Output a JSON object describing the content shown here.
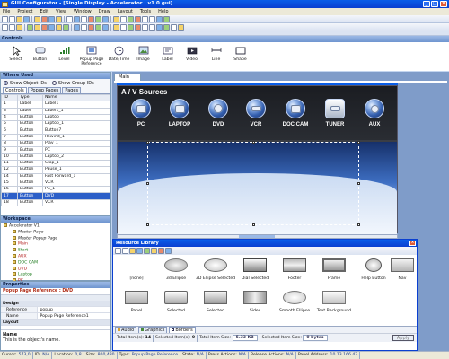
{
  "window": {
    "title": "GUI Configurator - [Single Display - Accelerator : v1.0.gui]"
  },
  "menu": [
    "File",
    "Project",
    "Edit",
    "View",
    "Window",
    "Draw",
    "Layout",
    "Tools",
    "Help"
  ],
  "controls_panel": {
    "title": "Controls",
    "items": [
      {
        "label": "Select",
        "icon": "pointer-icon"
      },
      {
        "label": "Button",
        "icon": "button-icon"
      },
      {
        "label": "Level",
        "icon": "level-icon"
      },
      {
        "label": "Popup Page Reference",
        "icon": "popup-page-icon"
      },
      {
        "label": "Date/Time",
        "icon": "clock-icon"
      },
      {
        "label": "Image",
        "icon": "image-icon"
      },
      {
        "label": "Label",
        "icon": "label-icon"
      },
      {
        "label": "Video",
        "icon": "video-icon"
      },
      {
        "label": "Line",
        "icon": "line-icon"
      },
      {
        "label": "Shape",
        "icon": "shape-icon"
      }
    ]
  },
  "where_used": {
    "title": "Where Used",
    "radio_object": "Show Object IDs",
    "radio_group": "Show Group IDs",
    "tabs": [
      "Controls",
      "Popup Pages",
      "Pages"
    ],
    "columns": [
      "ID",
      "Type",
      "Name"
    ],
    "rows": [
      [
        "1",
        "Label",
        "Label1"
      ],
      [
        "3",
        "Label",
        "Label1_1"
      ],
      [
        "4",
        "Button",
        "Laptop"
      ],
      [
        "5",
        "Button",
        "Laptop_1"
      ],
      [
        "6",
        "Button",
        "Button7"
      ],
      [
        "7",
        "Button",
        "Rewind_1"
      ],
      [
        "8",
        "Button",
        "Play_1"
      ],
      [
        "9",
        "Button",
        "PC"
      ],
      [
        "10",
        "Button",
        "Laptop_2"
      ],
      [
        "11",
        "Button",
        "Stop_1"
      ],
      [
        "12",
        "Button",
        "Pause_1"
      ],
      [
        "14",
        "Button",
        "Fast Forward_1"
      ],
      [
        "15",
        "Button",
        "VCR"
      ],
      [
        "16",
        "Button",
        "PC_1"
      ],
      [
        "17",
        "Button",
        "DVD"
      ],
      [
        "18",
        "Button",
        "VCR"
      ]
    ],
    "selected_row": 14
  },
  "workspace": {
    "title": "Workspace",
    "items": [
      "Accelerator V1",
      "Master Page",
      "Master Popup Page",
      "Main",
      "Start",
      "AUX",
      "DOC CAM",
      "DVD",
      "Laptop",
      "PC",
      "Tuner"
    ]
  },
  "properties": {
    "title": "Properties",
    "object": "Popup Page Reference : DVD",
    "section_design": "Design",
    "rows": [
      {
        "key": "Reference",
        "value": "popup"
      },
      {
        "key": "Name",
        "value": "Popup Page Reference1"
      }
    ],
    "section_layout": "Layout",
    "desc_title": "Name",
    "desc_text": "This is the object's name."
  },
  "document": {
    "tab": "Main",
    "heading": "A / V Sources",
    "sources": [
      {
        "label": "PC",
        "icon": "monitor-icon"
      },
      {
        "label": "LAPTOP",
        "icon": "laptop-icon"
      },
      {
        "label": "DVD",
        "icon": "disc-icon"
      },
      {
        "label": "VCR",
        "icon": "tape-icon"
      },
      {
        "label": "DOC CAM",
        "icon": "doc-camera-icon"
      },
      {
        "label": "TUNER",
        "icon": "tuner-icon"
      },
      {
        "label": "AUX",
        "icon": "aux-icon"
      }
    ]
  },
  "resource_library": {
    "title": "Resource Library",
    "items_row1": [
      "[none]",
      "3d Ellipse",
      "3D Ellipse Selected",
      "Dial Selected",
      "Footer",
      "Frame",
      "Help Button",
      "Nav"
    ],
    "items_row2": [
      "Panel",
      "Selected",
      "Selected",
      "Sides",
      "Smooth Ellipse",
      "Text Background"
    ],
    "tabs": [
      "Audio",
      "Graphics",
      "Borders"
    ],
    "status": {
      "total_items": "Total Item(s):",
      "total_items_value": "14",
      "selected_items": "Selected Item(s):",
      "selected_items_value": "0",
      "total_size": "Total Item Size:",
      "total_size_value": "5.33 KB",
      "selected_size": "Selected Item Size:",
      "selected_size_value": "0 bytes"
    },
    "apply": "Apply"
  },
  "statusbar": [
    {
      "k": "Cursor:",
      "v": "573,0"
    },
    {
      "k": "ID:",
      "v": "N/A"
    },
    {
      "k": "Location:",
      "v": "0,8"
    },
    {
      "k": "Size:",
      "v": "800,480"
    },
    {
      "k": "Type:",
      "v": "Popup Page Reference"
    },
    {
      "k": "State:",
      "v": "N/A"
    },
    {
      "k": "Press Actions:",
      "v": "N/A"
    },
    {
      "k": "Release Actions:",
      "v": "N/A"
    },
    {
      "k": "Panel Address:",
      "v": "10.13.166.47"
    }
  ]
}
